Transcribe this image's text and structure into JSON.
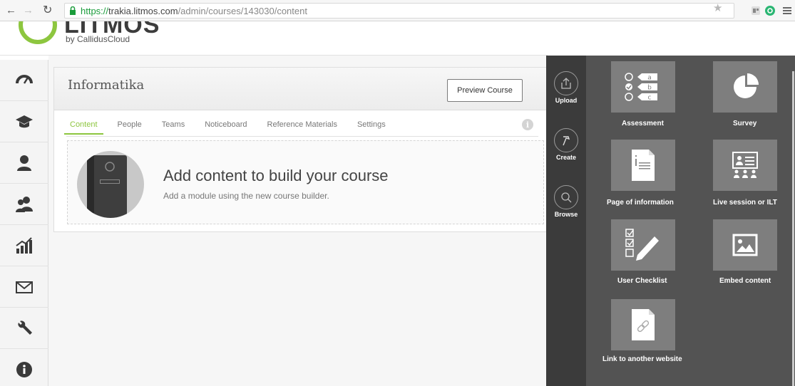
{
  "browser": {
    "url_scheme": "https://",
    "url_host": "trakia.litmos.com",
    "url_path": "/admin/courses/143030/content"
  },
  "brand": {
    "logo_word": "LITMOS",
    "logo_sub": "by CallidusCloud",
    "accent": "#8dc63f"
  },
  "sidebar": {
    "items": [
      {
        "icon": "dashboard-icon"
      },
      {
        "icon": "courses-icon"
      },
      {
        "icon": "user-icon"
      },
      {
        "icon": "teams-icon"
      },
      {
        "icon": "reports-icon"
      },
      {
        "icon": "messages-icon"
      },
      {
        "icon": "settings-wrench-icon"
      },
      {
        "icon": "info-icon"
      }
    ]
  },
  "course": {
    "title": "Informatika",
    "preview_label": "Preview Course",
    "tabs": [
      {
        "label": "Content",
        "active": true
      },
      {
        "label": "People"
      },
      {
        "label": "Teams"
      },
      {
        "label": "Noticeboard"
      },
      {
        "label": "Reference Materials"
      },
      {
        "label": "Settings"
      }
    ],
    "empty_title": "Add content to build your course",
    "empty_sub": "Add a module using the new course builder."
  },
  "panel": {
    "actions": [
      {
        "label": "Upload"
      },
      {
        "label": "Create",
        "active": true
      },
      {
        "label": "Browse"
      }
    ],
    "tiles": [
      {
        "label": "Assessment",
        "icon": "assessment-icon",
        "options": [
          "a",
          "b",
          "c"
        ]
      },
      {
        "label": "Survey",
        "icon": "pie-chart-icon"
      },
      {
        "label": "Page of information",
        "icon": "document-icon"
      },
      {
        "label": "Live session or ILT",
        "icon": "presenter-icon"
      },
      {
        "label": "User Checklist",
        "icon": "checklist-icon"
      },
      {
        "label": "Embed content",
        "icon": "image-icon"
      },
      {
        "label": "Link to another website",
        "icon": "link-icon"
      }
    ]
  }
}
